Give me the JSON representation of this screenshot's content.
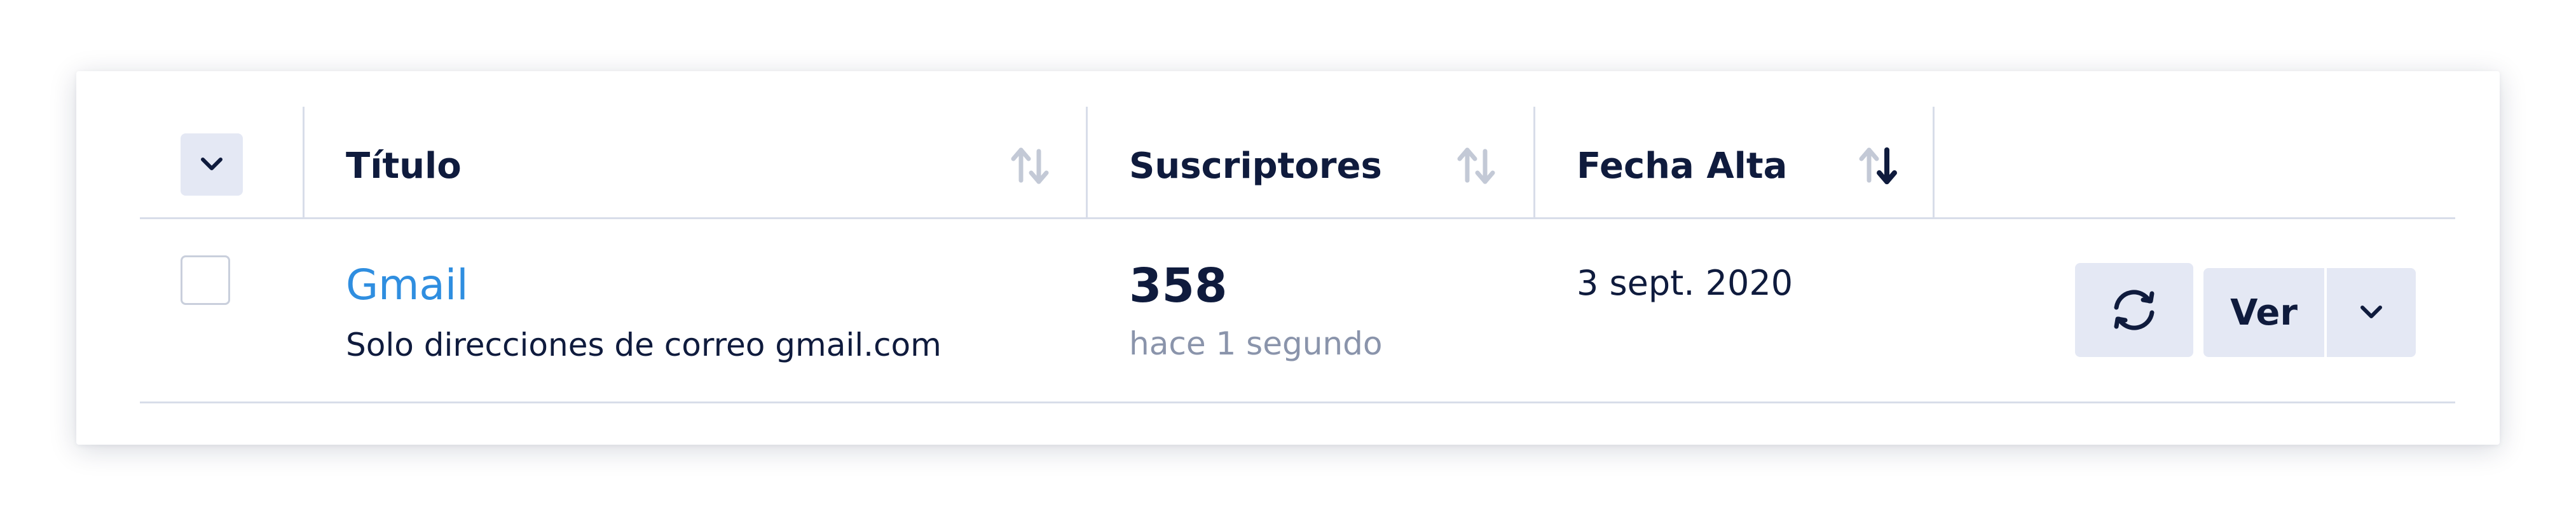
{
  "table": {
    "columns": [
      {
        "label": "Título",
        "sort": "none"
      },
      {
        "label": "Suscriptores",
        "sort": "none"
      },
      {
        "label": "Fecha Alta",
        "sort": "descending"
      }
    ],
    "rows": [
      {
        "title": "Gmail",
        "description": "Solo direcciones de correo gmail.com",
        "subscribers": "358",
        "subscribers_updated": "hace 1 segundo",
        "date": "3 sept. 2020",
        "actions": {
          "refresh_icon": "refresh-icon",
          "view_label": "Ver",
          "more_icon": "chevron-down-icon"
        }
      }
    ]
  },
  "colors": {
    "link": "#2f8ee0",
    "text": "#0f1b3d",
    "muted": "#8a94ab",
    "button_bg": "#e4e8f4",
    "divider": "#d8dde9"
  }
}
